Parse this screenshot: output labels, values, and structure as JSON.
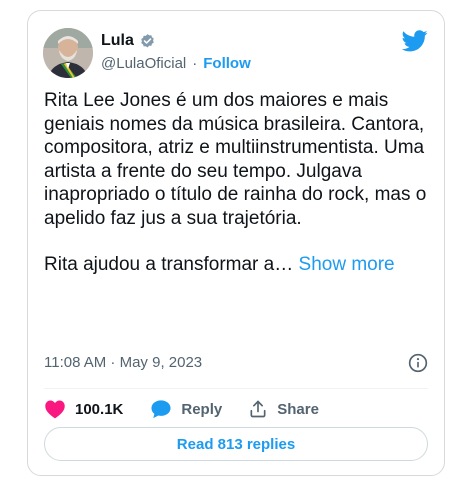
{
  "author": {
    "display_name": "Lula",
    "handle": "@LulaOficial",
    "separator": "·",
    "follow_label": "Follow",
    "verified": true
  },
  "tweet": {
    "paragraph_1": "Rita Lee Jones é um dos maiores e mais geniais nomes da música brasileira. Cantora, compositora, atriz e multiinstrumentista. Uma artista a frente do seu tempo. Julgava inapropriado o título de rainha do rock, mas o apelido faz jus a sua trajetória.",
    "paragraph_2": "Rita ajudou a transformar a…",
    "show_more_label": "Show more",
    "timestamp": "11:08 AM · May 9, 2023"
  },
  "actions": {
    "like_count": "100.1K",
    "reply_label": "Reply",
    "share_label": "Share"
  },
  "read_replies_label": "Read 813 replies",
  "colors": {
    "accent": "#1d9bf0",
    "like": "#f91880",
    "text": "#0f1419",
    "secondary": "#536471"
  },
  "icons": [
    "verified-badge-icon",
    "twitter-bird-icon",
    "info-icon",
    "heart-icon",
    "reply-bubble-icon",
    "share-icon"
  ]
}
